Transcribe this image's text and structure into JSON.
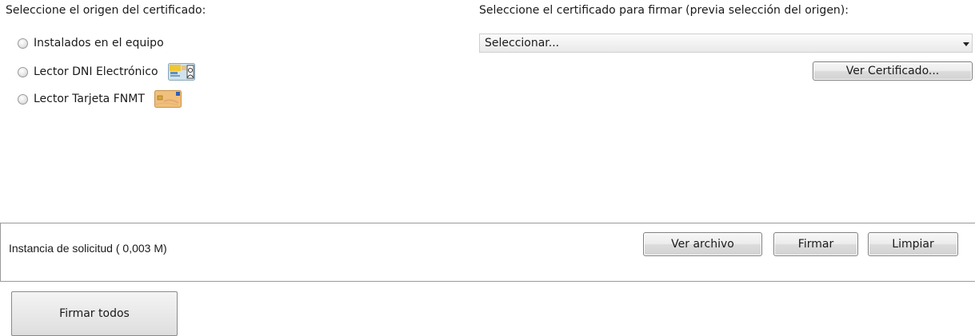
{
  "origin": {
    "heading": "Seleccione el origen del certificado:",
    "options": [
      {
        "label": "Instalados en el equipo"
      },
      {
        "label": "Lector DNI Electrónico",
        "icon": "dni-card-icon"
      },
      {
        "label": "Lector Tarjeta FNMT",
        "icon": "fnmt-card-icon"
      }
    ]
  },
  "certificate": {
    "heading": "Seleccione el certificado para firmar (previa selección del origen):",
    "select_value": "Seleccionar...",
    "view_button": "Ver Certificado..."
  },
  "document": {
    "label": "Instancia de solicitud ( 0,003 M)",
    "view_button": "Ver archivo",
    "sign_button": "Firmar",
    "clear_button": "Limpiar"
  },
  "footer": {
    "sign_all_button": "Firmar todos"
  }
}
